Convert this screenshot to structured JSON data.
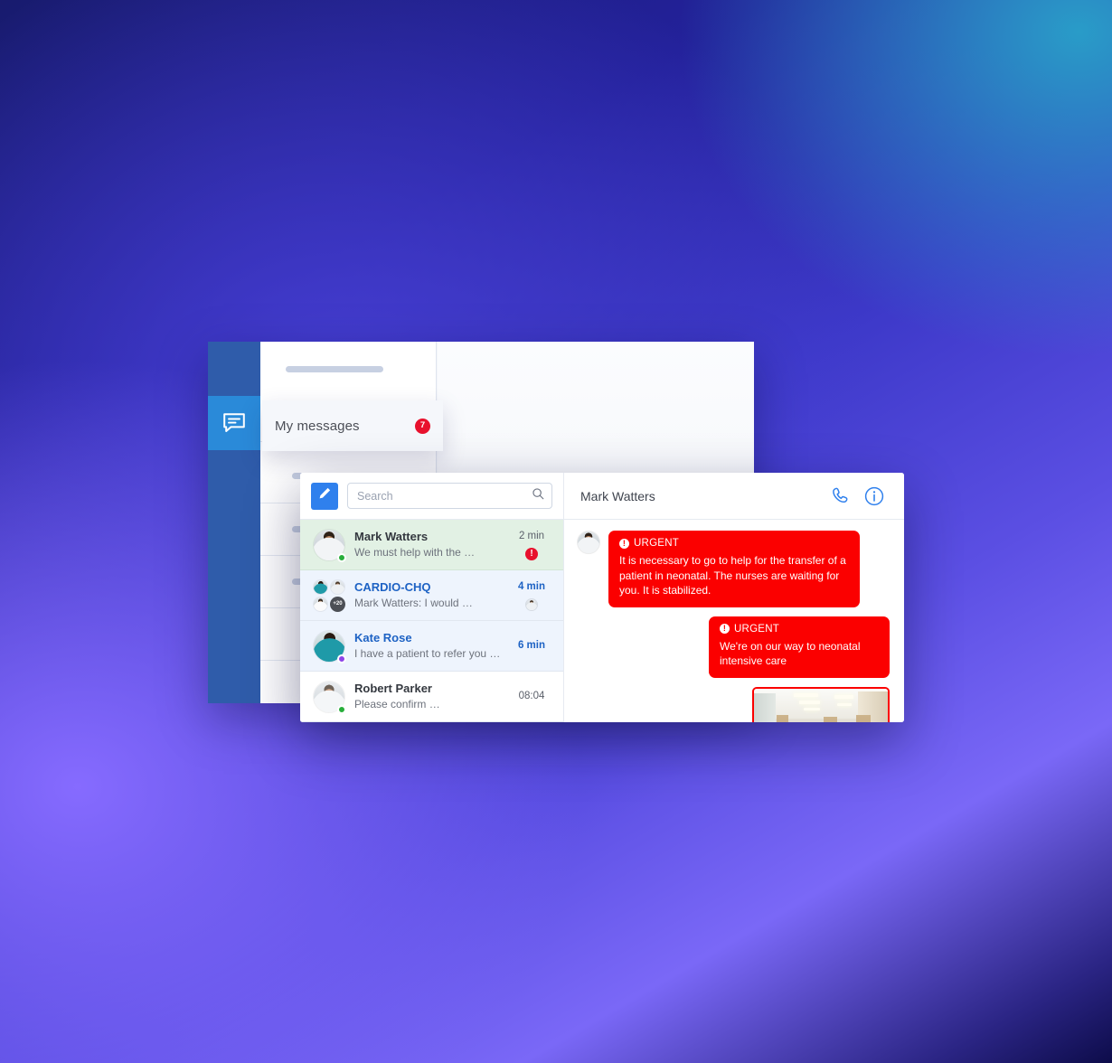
{
  "background_app": {
    "rail": {
      "active_icon": "chat-bubble-icon"
    },
    "menu": {
      "label": "My messages",
      "badge": "7"
    }
  },
  "chat_app": {
    "toolbar": {
      "compose_icon": "pencil-icon",
      "search": {
        "placeholder": "Search",
        "value": "",
        "icon": "search-icon"
      }
    },
    "conversation_header": {
      "peer_name": "Mark Watters",
      "call_icon": "phone-icon",
      "info_icon": "info-circle-icon"
    },
    "conversations": [
      {
        "name": "Mark Watters",
        "snippet": "We must help with the …",
        "time": "2 min",
        "state": "urgent",
        "presence": "online",
        "indicator": "urgent-exclamation",
        "indicator_text": "!",
        "avatar_type": "single",
        "avatar_style": "ph-doc1"
      },
      {
        "name": "CARDIO-CHQ",
        "snippet": "Mark Watters: I would …",
        "time": "4 min",
        "state": "unread",
        "presence": "none",
        "indicator": "read-receipt-avatar",
        "indicator_text": "",
        "avatar_type": "group",
        "group_more": "+20",
        "group_styles": [
          "ph-nurse",
          "ph-doc2",
          "ph-doc4"
        ]
      },
      {
        "name": "Kate Rose",
        "snippet": "I have a patient to refer you …",
        "time": "6 min",
        "state": "unread",
        "presence": "busy",
        "indicator": "none",
        "indicator_text": "",
        "avatar_type": "single",
        "avatar_style": "ph-nurse"
      },
      {
        "name": "Robert Parker",
        "snippet": "Please confirm …",
        "time": "08:04",
        "state": "read",
        "presence": "online",
        "indicator": "none",
        "indicator_text": "",
        "avatar_type": "single",
        "avatar_style": "ph-doc3"
      }
    ],
    "messages": [
      {
        "direction": "incoming",
        "kind": "text",
        "urgent_label": "URGENT",
        "text": "It is necessary to go to help for the transfer of a patient in neonatal. The nurses are waiting for you. It is stabilized.",
        "avatar_style": "ph-doc1"
      },
      {
        "direction": "outgoing",
        "kind": "text",
        "urgent_label": "URGENT",
        "text": "We're on our way to neonatal intensive care"
      },
      {
        "direction": "outgoing",
        "kind": "photo",
        "photo_alt": "hospital-corridor-photo"
      }
    ]
  },
  "colors": {
    "urgent_red": "#fb0000",
    "badge_red": "#e8112d",
    "accent_blue": "#2f80ed",
    "link_blue": "#1d62c4",
    "rail_blue": "#2f5caa",
    "rail_active_blue": "#2a8ad9",
    "urgent_row_green": "#e2f1e4",
    "unread_row_blue": "#eef4fd",
    "online_green": "#27ae3a",
    "busy_purple": "#8e44e8"
  }
}
